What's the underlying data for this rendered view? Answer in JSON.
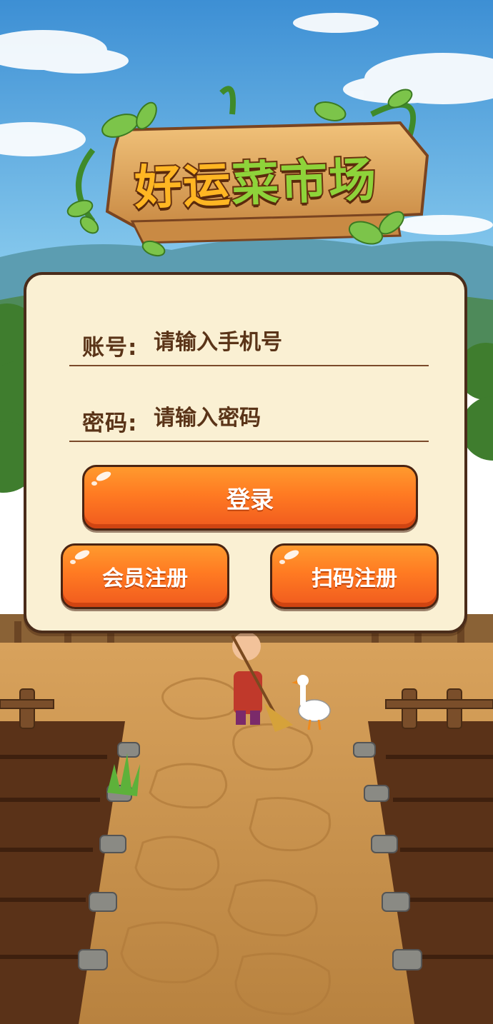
{
  "title": {
    "part1": "好运",
    "part2": "菜市场"
  },
  "login": {
    "account_label": "账号:",
    "account_placeholder": "请输入手机号",
    "password_label": "密码:",
    "password_placeholder": "请输入密码",
    "login_button": "登录",
    "member_register_button": "会员注册",
    "scan_register_button": "扫码注册"
  },
  "colors": {
    "panel_bg": "#faf0d3",
    "panel_border": "#4a2c1a",
    "button_orange": "#ff7a22",
    "text_brown": "#5a3418",
    "title_yellow": "#ffb623",
    "title_green": "#8ed33a"
  }
}
